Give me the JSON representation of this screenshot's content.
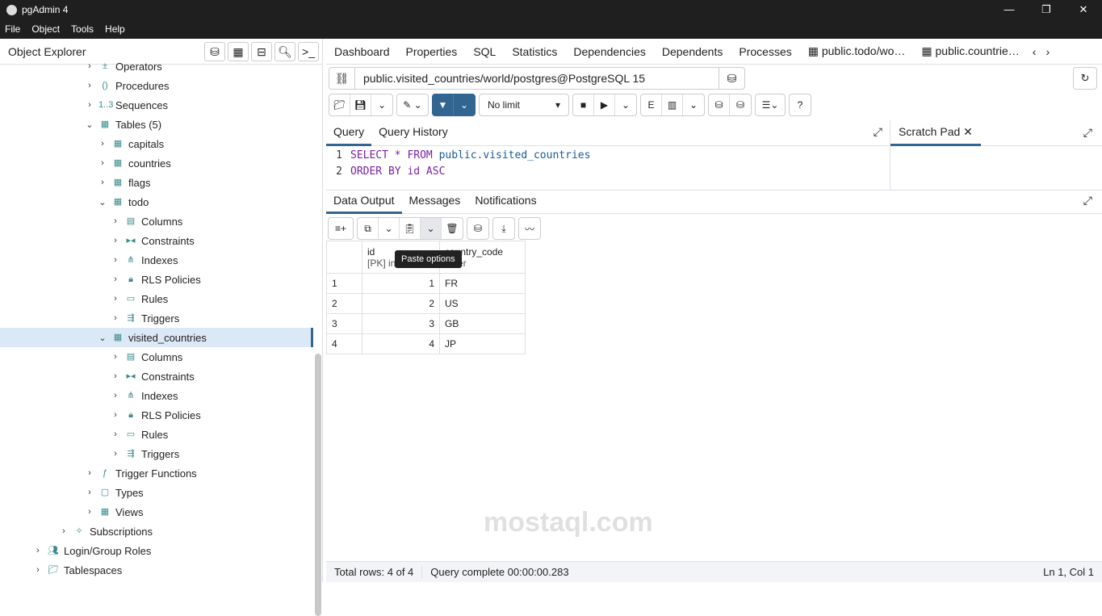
{
  "window": {
    "title": "pgAdmin 4"
  },
  "menu": [
    "File",
    "Object",
    "Tools",
    "Help"
  ],
  "object_explorer": {
    "title": "Object Explorer",
    "tree": [
      {
        "label": "Operators",
        "depth": 3,
        "icon": "operators-icon",
        "expanded": false
      },
      {
        "label": "Procedures",
        "depth": 3,
        "icon": "procedures-icon",
        "expanded": false
      },
      {
        "label": "Sequences",
        "depth": 3,
        "icon": "sequences-icon",
        "expanded": false
      },
      {
        "label": "Tables (5)",
        "depth": 3,
        "icon": "tables-icon",
        "expanded": true
      },
      {
        "label": "capitals",
        "depth": 4,
        "icon": "table-icon",
        "expanded": false
      },
      {
        "label": "countries",
        "depth": 4,
        "icon": "table-icon",
        "expanded": false
      },
      {
        "label": "flags",
        "depth": 4,
        "icon": "table-icon",
        "expanded": false
      },
      {
        "label": "todo",
        "depth": 4,
        "icon": "table-icon",
        "expanded": true
      },
      {
        "label": "Columns",
        "depth": 5,
        "icon": "columns-icon",
        "expanded": false
      },
      {
        "label": "Constraints",
        "depth": 5,
        "icon": "constraints-icon",
        "expanded": false
      },
      {
        "label": "Indexes",
        "depth": 5,
        "icon": "indexes-icon",
        "expanded": false
      },
      {
        "label": "RLS Policies",
        "depth": 5,
        "icon": "rls-policies-icon",
        "expanded": false
      },
      {
        "label": "Rules",
        "depth": 5,
        "icon": "rules-icon",
        "expanded": false
      },
      {
        "label": "Triggers",
        "depth": 5,
        "icon": "triggers-icon",
        "expanded": false
      },
      {
        "label": "visited_countries",
        "depth": 4,
        "icon": "table-icon",
        "expanded": true,
        "selected": true
      },
      {
        "label": "Columns",
        "depth": 5,
        "icon": "columns-icon",
        "expanded": false
      },
      {
        "label": "Constraints",
        "depth": 5,
        "icon": "constraints-icon",
        "expanded": false
      },
      {
        "label": "Indexes",
        "depth": 5,
        "icon": "indexes-icon",
        "expanded": false
      },
      {
        "label": "RLS Policies",
        "depth": 5,
        "icon": "rls-policies-icon",
        "expanded": false
      },
      {
        "label": "Rules",
        "depth": 5,
        "icon": "rules-icon",
        "expanded": false
      },
      {
        "label": "Triggers",
        "depth": 5,
        "icon": "triggers-icon",
        "expanded": false
      },
      {
        "label": "Trigger Functions",
        "depth": 3,
        "icon": "trigger-functions-icon",
        "expanded": false
      },
      {
        "label": "Types",
        "depth": 3,
        "icon": "types-icon",
        "expanded": false
      },
      {
        "label": "Views",
        "depth": 3,
        "icon": "views-icon",
        "expanded": false
      },
      {
        "label": "Subscriptions",
        "depth": 2,
        "icon": "subscriptions-icon",
        "expanded": false
      },
      {
        "label": "Login/Group Roles",
        "depth": 1,
        "icon": "roles-icon",
        "expanded": false
      },
      {
        "label": "Tablespaces",
        "depth": 1,
        "icon": "tablespaces-icon",
        "expanded": false
      }
    ]
  },
  "tabs": [
    "Dashboard",
    "Properties",
    "SQL",
    "Statistics",
    "Dependencies",
    "Dependents",
    "Processes",
    "public.todo/wo…",
    "public.countrie…"
  ],
  "connection": "public.visited_countries/world/postgres@PostgreSQL 15",
  "limit": "No limit",
  "query_tabs": {
    "query": "Query",
    "history": "Query History",
    "scratch": "Scratch Pad"
  },
  "sql": {
    "line1_kw": "SELECT * FROM",
    "line1_id": "public.visited_countries",
    "line2": "ORDER BY id ASC"
  },
  "output_tabs": [
    "Data Output",
    "Messages",
    "Notifications"
  ],
  "tooltip": "Paste options",
  "grid": {
    "columns": [
      {
        "name": "id",
        "type": "[PK] in"
      },
      {
        "name": "country_code",
        "type": "acter"
      }
    ],
    "rows": [
      [
        "1",
        "1",
        "FR"
      ],
      [
        "2",
        "2",
        "US"
      ],
      [
        "3",
        "3",
        "GB"
      ],
      [
        "4",
        "4",
        "JP"
      ]
    ]
  },
  "status": {
    "rows": "Total rows: 4 of 4",
    "query": "Query complete 00:00:00.283",
    "cursor": "Ln 1, Col 1"
  },
  "watermark": "mostaql.com",
  "colors": {
    "accent": "#326690",
    "titlebar": "#1f1f1f"
  }
}
